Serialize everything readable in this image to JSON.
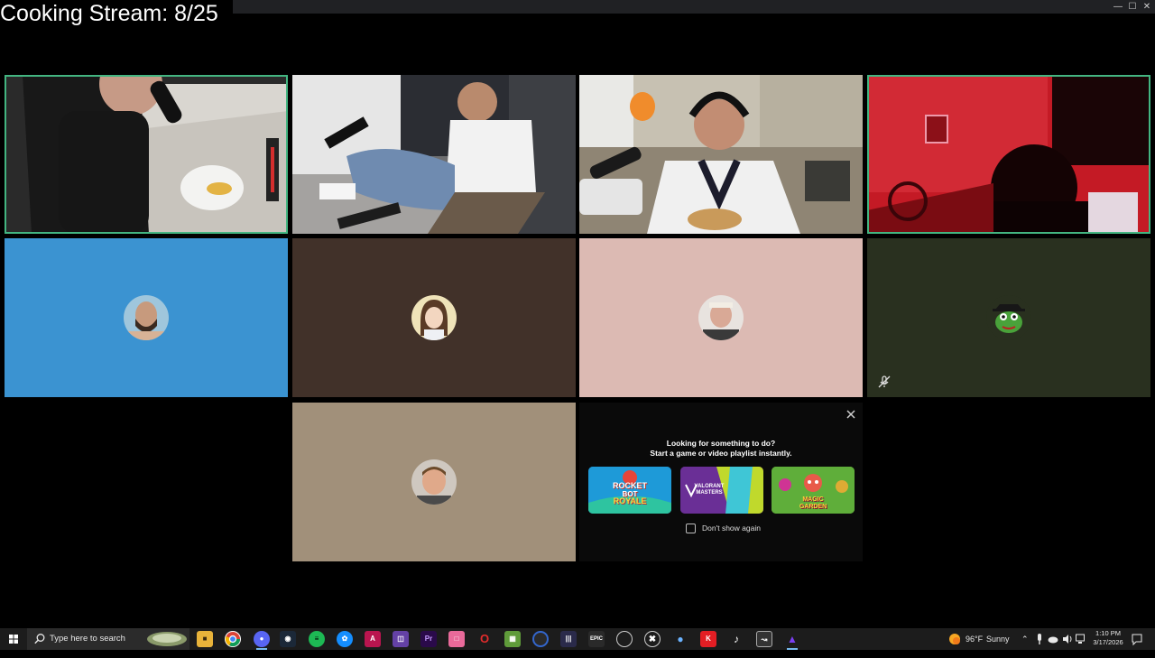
{
  "window": {
    "title": "Cooking Stream: 8/25"
  },
  "participants": [
    {
      "name": "participant-1-video",
      "speaking": true
    },
    {
      "name": "participant-2-video",
      "speaking": false
    },
    {
      "name": "participant-3-video",
      "speaking": false
    },
    {
      "name": "participant-4-video",
      "speaking": true
    },
    {
      "name": "participant-5-avatar",
      "bg": "#3b93d1"
    },
    {
      "name": "participant-6-avatar",
      "bg": "#413129"
    },
    {
      "name": "participant-7-avatar",
      "bg": "#dcbab3",
      "muted": false
    },
    {
      "name": "participant-8-avatar",
      "bg": "#29301f",
      "muted": true
    },
    {
      "name": "participant-9-avatar",
      "bg": "#a1907a"
    }
  ],
  "activity_popup": {
    "line1": "Looking for something to do?",
    "line2": "Start a game or video playlist instantly.",
    "games": [
      {
        "label": "ROCKET BOT ROYALE",
        "line_a": "ROCKET",
        "line_b": "BOT",
        "line_c": "ROYALE"
      },
      {
        "label": "VALORANT MASTERS",
        "line_a": "VALORANT",
        "line_b": "MASTERS"
      },
      {
        "label": "MAGIC GARDEN",
        "line_a": "MAGIC",
        "line_b": "GARDEN"
      }
    ],
    "dont_show_again": "Don't show again"
  },
  "taskbar": {
    "search_placeholder": "Type here to search",
    "weather_temp": "96°F",
    "weather_text": "Sunny",
    "time": "1:10 PM",
    "date": "3/17/2026",
    "icons": [
      "file-explorer-icon",
      "chrome-icon",
      "discord-icon",
      "steam-icon",
      "spotify-icon",
      "battlenet-icon",
      "app-a-icon",
      "twitch-icon",
      "premiere-icon",
      "app-icon",
      "opera-gx-icon",
      "minecraft-icon",
      "app-circle-icon",
      "app-bars-icon",
      "epic-games-icon",
      "obs-icon",
      "xbox-icon",
      "app-drop-icon",
      "app-red-icon",
      "tiktok-icon",
      "app-box-icon",
      "app-triangle-icon"
    ]
  },
  "colors": {
    "speaking_outline": "#43b581",
    "tile_blue": "#3b93d1",
    "tile_brown": "#413129",
    "tile_pink": "#dcbab3",
    "tile_olive": "#29301f",
    "tile_tan": "#a1907a"
  }
}
